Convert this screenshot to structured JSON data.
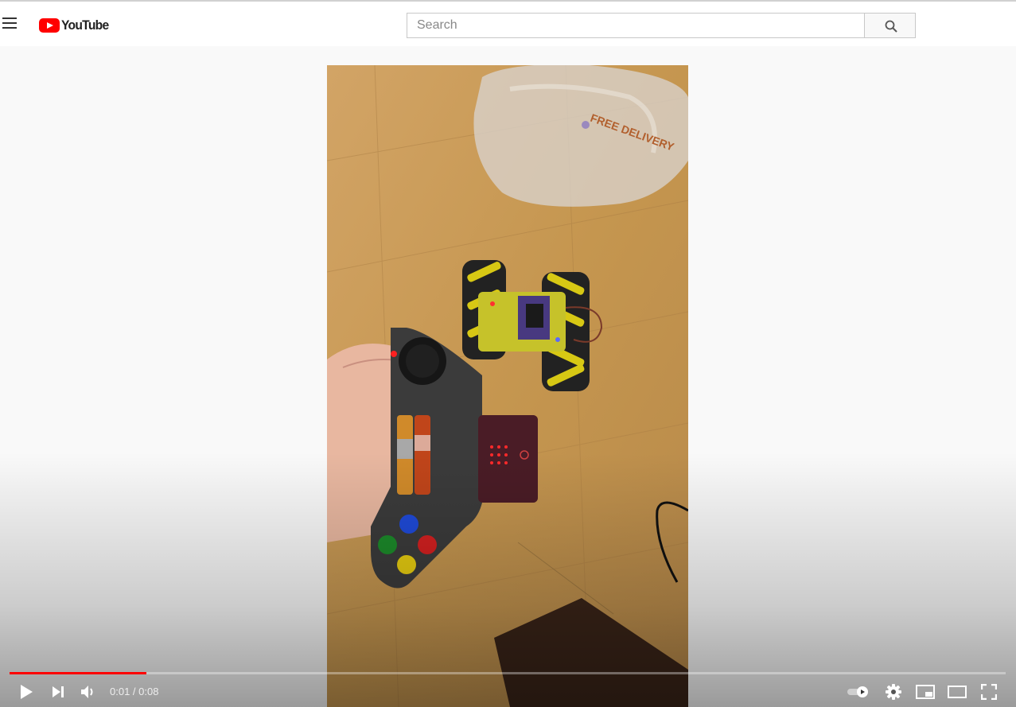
{
  "header": {
    "logo_text": "YouTube",
    "search": {
      "placeholder": "Search",
      "value": ""
    }
  },
  "player": {
    "time_current": "0:01",
    "time_separator": " / ",
    "time_duration": "0:08",
    "progress_fraction": 0.137,
    "colors": {
      "progress": "#ff0000",
      "logo": "#ff0000"
    }
  },
  "video_scene": {
    "floor_color": "#c79a5a",
    "icons": [
      "menu-icon",
      "search-icon",
      "play-icon",
      "next-icon",
      "volume-icon",
      "autoplay-toggle-icon",
      "settings-icon",
      "miniplayer-icon",
      "theater-icon",
      "fullscreen-icon"
    ]
  }
}
